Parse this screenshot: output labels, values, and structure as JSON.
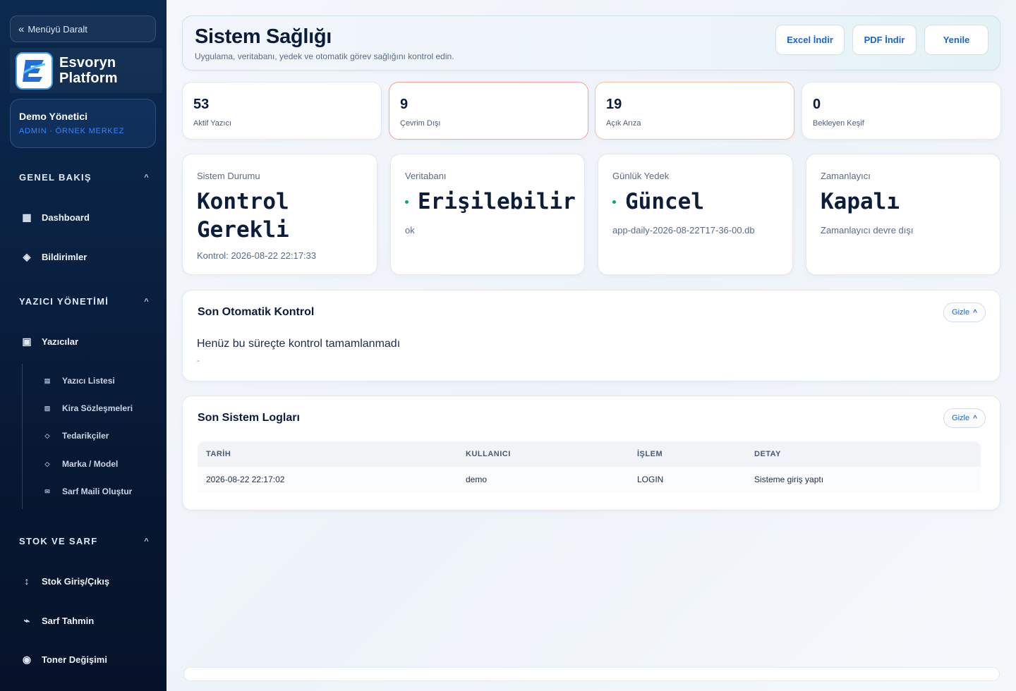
{
  "sidebar": {
    "collapse_label": "Menüyü Daralt",
    "brand_name": "Esvoryn Platform",
    "user": {
      "name": "Demo Yönetici",
      "role": "ADMIN · ÖRNEK MERKEZ"
    },
    "sections": [
      {
        "title": "GENEL BAKIŞ",
        "items": [
          {
            "label": "Dashboard",
            "icon": "grid-icon"
          },
          {
            "label": "Bildirimler",
            "icon": "diamond-icon"
          }
        ]
      },
      {
        "title": "YAZICI YÖNETİMİ",
        "items": [
          {
            "label": "Yazıcılar",
            "icon": "printer-icon",
            "children": [
              {
                "label": "Yazıcı Listesi",
                "icon": "list-icon"
              },
              {
                "label": "Kira Sözleşmeleri",
                "icon": "contract-icon"
              },
              {
                "label": "Tedarikçiler",
                "icon": "small-diamond-icon"
              },
              {
                "label": "Marka / Model",
                "icon": "small-diamond-icon"
              },
              {
                "label": "Sarf Maili Oluştur",
                "icon": "mail-icon"
              }
            ]
          }
        ]
      },
      {
        "title": "STOK VE SARF",
        "items": [
          {
            "label": "Stok Giriş/Çıkış",
            "icon": "updown-arrow-icon"
          },
          {
            "label": "Sarf Tahmin",
            "icon": "trend-icon"
          },
          {
            "label": "Toner Değişimi",
            "icon": "target-icon"
          }
        ]
      }
    ]
  },
  "header": {
    "title": "Sistem Sağlığı",
    "subtitle": "Uygulama, veritabanı, yedek ve otomatik görev sağlığını kontrol edin.",
    "buttons": {
      "excel": "Excel İndir",
      "pdf": "PDF İndir",
      "refresh": "Yenile"
    }
  },
  "kpis": [
    {
      "value": "53",
      "label": "Aktif Yazıcı",
      "border": "#e2e8f1"
    },
    {
      "value": "9",
      "label": "Çevrim Dışı",
      "border": "#f0a3a3"
    },
    {
      "value": "19",
      "label": "Açık Arıza",
      "border": "#f3c29a"
    },
    {
      "value": "0",
      "label": "Bekleyen Keşif",
      "border": "#e2e8f1"
    }
  ],
  "status_cards": [
    {
      "label": "Sistem Durumu",
      "value": "Kontrol Gerekli",
      "sub": "Kontrol: 2026-08-22 22:17:33"
    },
    {
      "label": "Veritabanı",
      "value": "Erişilebilir",
      "sub": "ok"
    },
    {
      "label": "Günlük Yedek",
      "value": "Güncel",
      "sub": "app-daily-2026-08-22T17-36-00.db"
    },
    {
      "label": "Zamanlayıcı",
      "value": "Kapalı",
      "sub": "Zamanlayıcı devre dışı"
    }
  ],
  "auto_check": {
    "title": "Son Otomatik Kontrol",
    "hide_label": "Gizle",
    "message": "Henüz bu süreçte kontrol tamamlanmadı",
    "detail": "-"
  },
  "logs": {
    "title": "Son Sistem Logları",
    "hide_label": "Gizle",
    "columns": [
      "TARİH",
      "KULLANICI",
      "İŞLEM",
      "DETAY"
    ],
    "rows": [
      [
        "2026-08-22 22:17:02",
        "demo",
        "LOGIN",
        "Sisteme giriş yaptı"
      ]
    ]
  },
  "colors": {
    "accent": "#1d63c5",
    "ok_dot": "#11a36e",
    "sidebar_bg": "#0a2142"
  }
}
